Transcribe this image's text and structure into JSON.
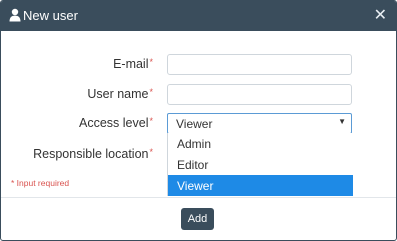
{
  "dialog": {
    "title": "New user",
    "title_icon": "user-icon",
    "close_glyph": "✕"
  },
  "form": {
    "email_label": "E-mail",
    "username_label": "User name",
    "access_level_label": "Access level",
    "responsible_location_label": "Responsible location",
    "required_marker": "*",
    "email_value": "",
    "username_value": ""
  },
  "access_level": {
    "selected": "Viewer",
    "options": [
      "Admin",
      "Editor",
      "Viewer"
    ]
  },
  "footer": {
    "required_note": "* Input required",
    "add_label": "Add"
  },
  "colors": {
    "header": "#3a4d5c",
    "selected_option": "#1e8ae6",
    "required": "#d9534f"
  }
}
